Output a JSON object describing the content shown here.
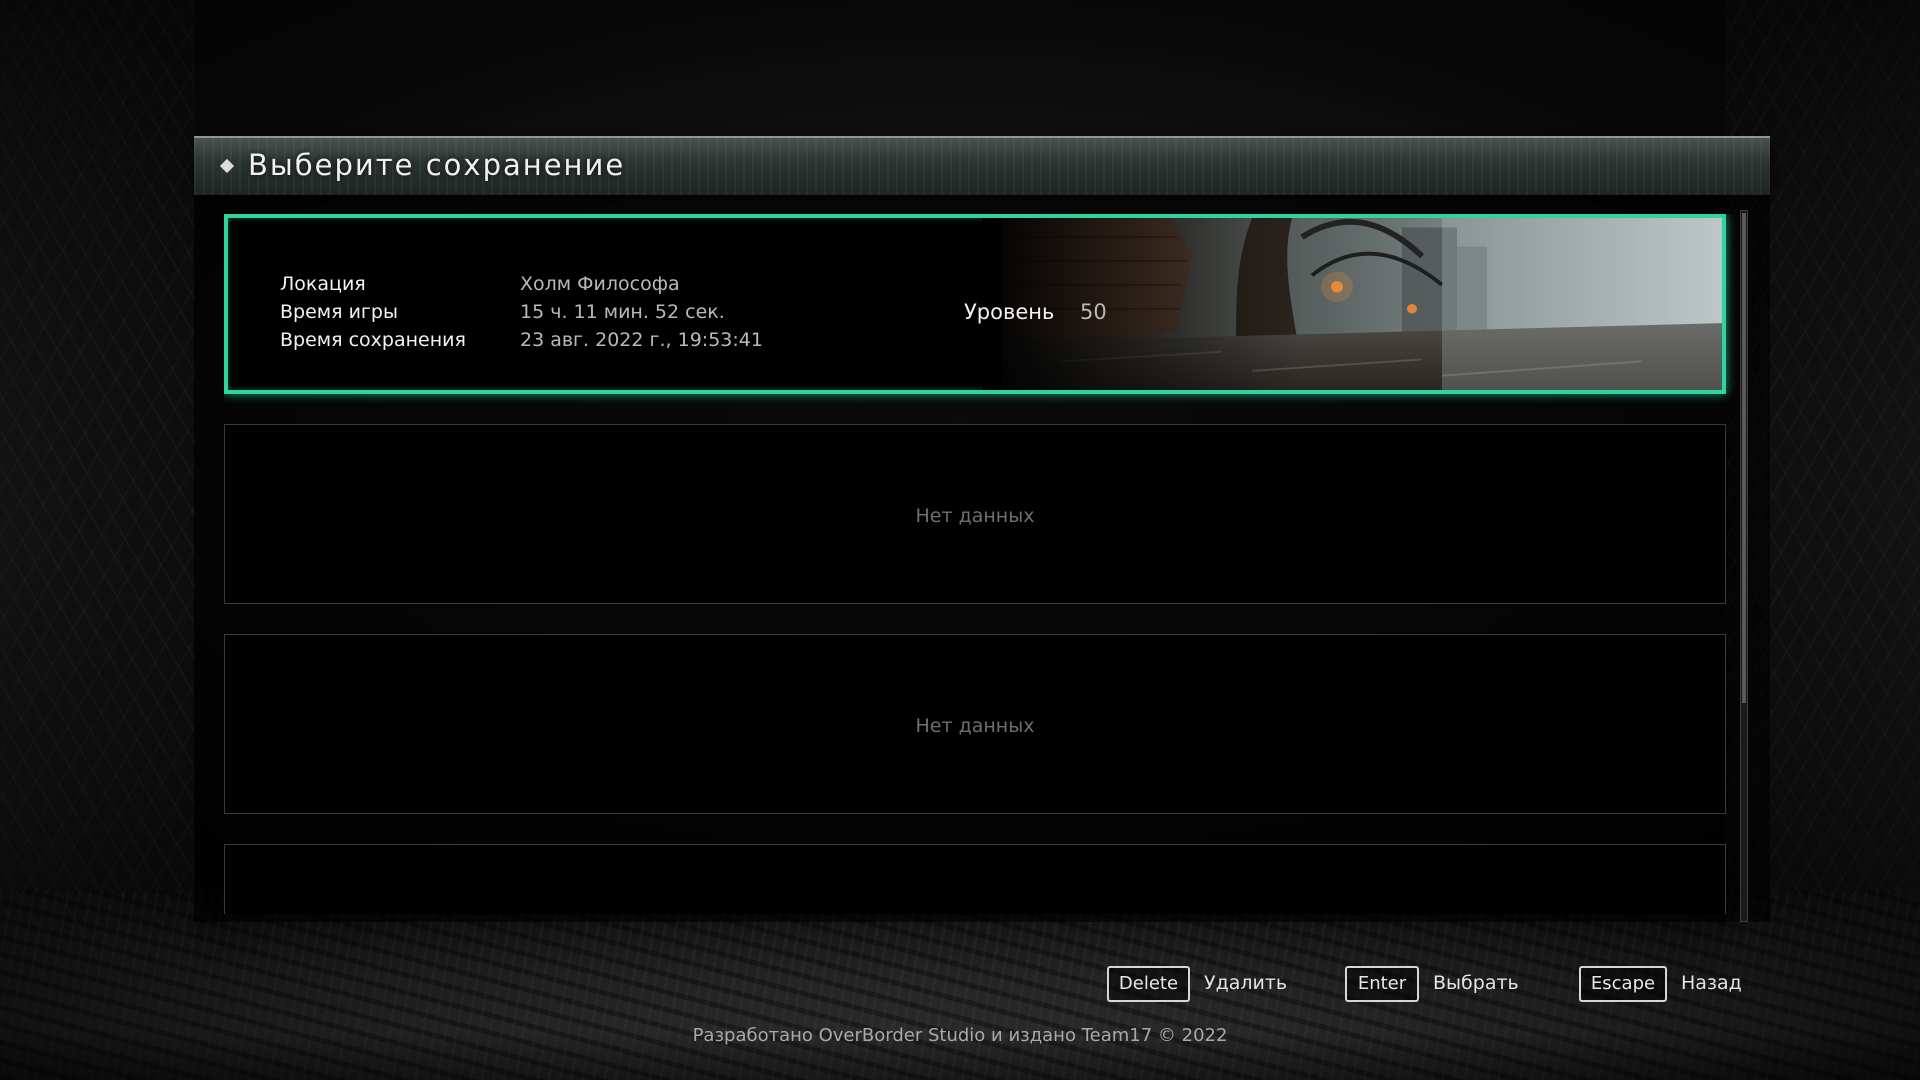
{
  "header": {
    "title": "Выберите сохранение"
  },
  "slots": [
    {
      "state": "filled",
      "labels": {
        "location": "Локация",
        "playtime": "Время игры",
        "savetime": "Время сохранения",
        "level": "Уровень"
      },
      "values": {
        "location": "Холм Философа",
        "playtime": "15 ч. 11 мин. 52 сек.",
        "savetime": "23 авг. 2022 г., 19:53:41",
        "level": "50"
      }
    },
    {
      "state": "empty",
      "empty_label": "Нет данных"
    },
    {
      "state": "empty",
      "empty_label": "Нет данных"
    },
    {
      "state": "empty",
      "empty_label": ""
    }
  ],
  "hints": [
    {
      "key": "Delete",
      "action": "Удалить"
    },
    {
      "key": "Enter",
      "action": "Выбрать"
    },
    {
      "key": "Escape",
      "action": "Назад"
    }
  ],
  "footer": {
    "credits": "Разработано OverBorder Studio и издано Team17 © 2022"
  },
  "colors": {
    "accent": "#2fd3a0",
    "empty_text": "#6f6f6f"
  }
}
